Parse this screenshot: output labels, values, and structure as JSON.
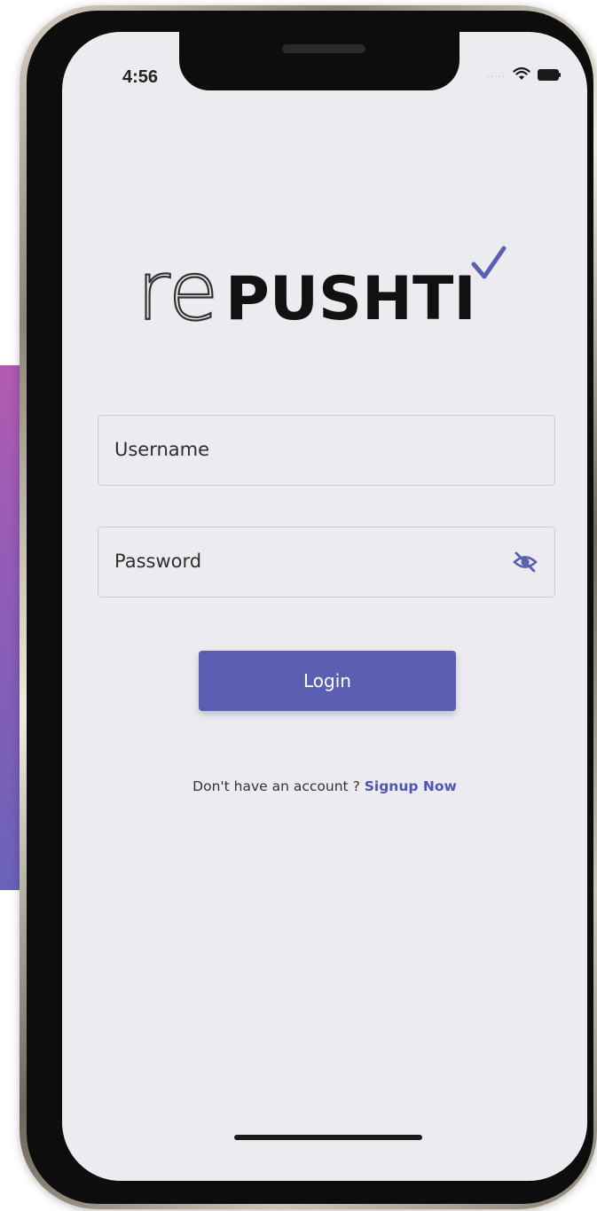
{
  "status_bar": {
    "time": "4:56",
    "signal_text": "....."
  },
  "logo": {
    "prefix": "re",
    "brand": "PUSHTI",
    "accent_color": "#5a5fb2",
    "check_color": "#5a5fb2"
  },
  "form": {
    "username_placeholder": "Username",
    "password_placeholder": "Password",
    "password_toggle_icon": "eye-off-icon"
  },
  "login_button": {
    "label": "Login",
    "color": "#5a5fb2"
  },
  "signup": {
    "prompt": "Don't have an account ?",
    "link_label": "Signup Now",
    "link_color": "#4f55b0"
  }
}
